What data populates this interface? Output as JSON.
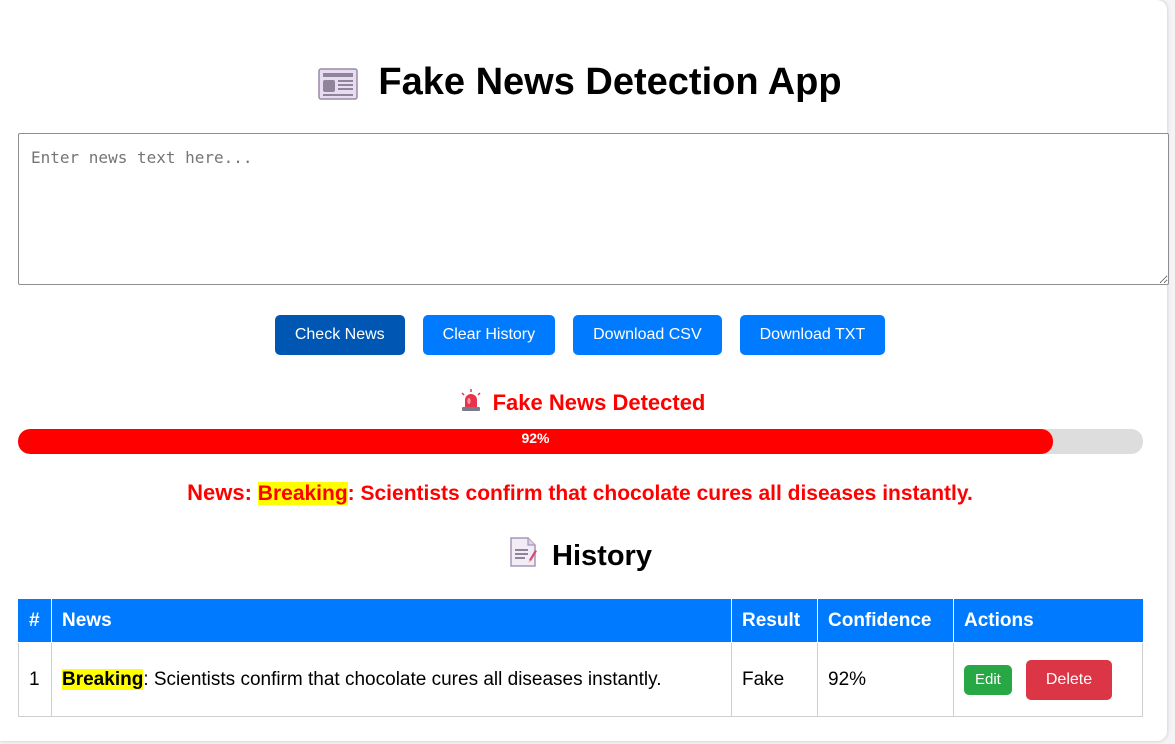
{
  "app": {
    "title": "Fake News Detection App"
  },
  "input": {
    "placeholder": "Enter news text here...",
    "value": ""
  },
  "buttons": {
    "check": "Check News",
    "clear": "Clear History",
    "download_csv": "Download CSV",
    "download_txt": "Download TXT"
  },
  "result": {
    "label": "Fake News Detected",
    "icon": "siren-icon",
    "color": "#ff0000",
    "confidence_percent": 92,
    "confidence_label": "92%"
  },
  "news": {
    "prefix": "News:",
    "highlight": "Breaking",
    "rest": ": Scientists confirm that chocolate cures all diseases instantly."
  },
  "history": {
    "title": "History",
    "icon": "memo-icon",
    "columns": [
      "#",
      "News",
      "Result",
      "Confidence",
      "Actions"
    ],
    "rows": [
      {
        "index": "1",
        "news_highlight": "Breaking",
        "news_rest": ": Scientists confirm that chocolate cures all diseases instantly.",
        "result": "Fake",
        "confidence": "92%",
        "edit_label": "Edit",
        "delete_label": "Delete"
      }
    ]
  },
  "colors": {
    "primary": "#007bff",
    "primary_active": "#0056b3",
    "danger": "#dc3545",
    "success": "#28a745",
    "highlight": "#ffff00"
  }
}
